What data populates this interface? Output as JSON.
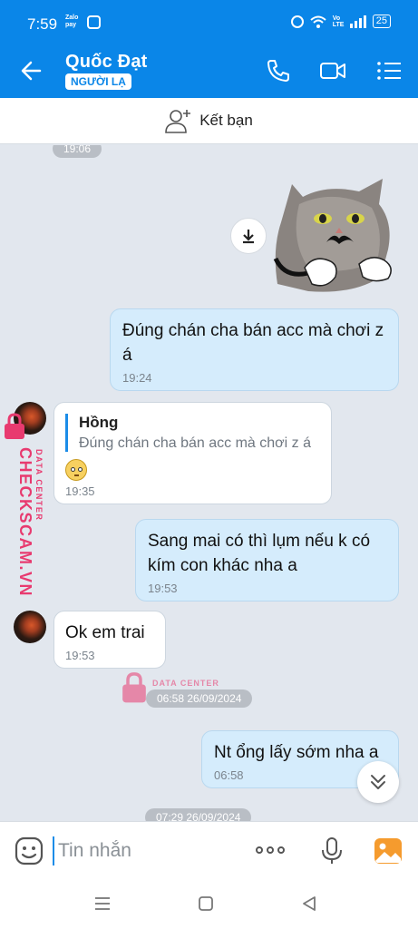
{
  "status_bar": {
    "time": "7:59",
    "zalopay_label": "Zalo pay",
    "volte": "Vo LTE",
    "battery": "25"
  },
  "header": {
    "contact_name": "Quốc Đạt",
    "badge": "NGƯỜI LẠ"
  },
  "add_friend": {
    "label": "Kết bạn"
  },
  "messages": [
    {
      "type": "time",
      "text": "19:06"
    },
    {
      "type": "sticker",
      "direction": "out"
    },
    {
      "type": "text",
      "direction": "out",
      "text": "Đúng chán cha bán acc mà chơi z á",
      "time": "19:24"
    },
    {
      "type": "reply",
      "direction": "in",
      "quote_name": "Hồng",
      "quote_text": "Đúng chán cha bán acc mà chơi z á",
      "time": "19:35"
    },
    {
      "type": "text",
      "direction": "out",
      "text": "Sang mai có thì lụm nếu k có kím con khác nha a",
      "time": "19:53"
    },
    {
      "type": "text",
      "direction": "in",
      "text": "Ok em trai",
      "time": "19:53"
    },
    {
      "type": "time",
      "text": "06:58 26/09/2024"
    },
    {
      "type": "text",
      "direction": "out",
      "text": "Nt ổng lấy sớm nha a",
      "time": "06:58"
    },
    {
      "type": "time",
      "text": "07:29 26/09/2024"
    }
  ],
  "watermark": {
    "brand": "CHECKSCAM.VN",
    "caption": "DATA CENTER"
  },
  "input": {
    "placeholder": "Tin nhắn"
  },
  "colors": {
    "brand_blue": "#0a86e8",
    "outgoing_bubble": "#d5ecfc",
    "chat_background": "#e2e7ee",
    "watermark_pink": "#e83a6f"
  }
}
